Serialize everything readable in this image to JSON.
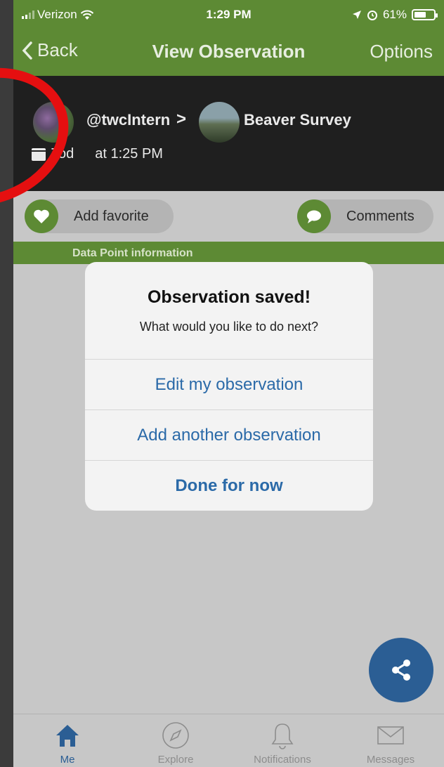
{
  "status_bar": {
    "carrier": "Verizon",
    "time": "1:29 PM",
    "battery_text": "61%",
    "battery_level": 0.61
  },
  "nav": {
    "back_label": "Back",
    "title": "View Observation",
    "options_label": "Options"
  },
  "header": {
    "username": "@twcIntern",
    "project": "Beaver Survey",
    "date_text": "Tod",
    "time_text": "at 1:25 PM"
  },
  "actions": {
    "favorite_label": "Add favorite",
    "comments_label": "Comments"
  },
  "section": {
    "title": "Data Point information"
  },
  "dialog": {
    "title": "Observation saved!",
    "message": "What would you like to do next?",
    "buttons": [
      "Edit my observation",
      "Add another observation",
      "Done for now"
    ]
  },
  "tabbar": {
    "items": [
      "Me",
      "Explore",
      "Notifications",
      "Messages"
    ]
  },
  "colors": {
    "brand_green": "#5d8a34",
    "accent_blue": "#2b5e94",
    "link_blue": "#2b6aa8",
    "annotation_red": "#e50f10"
  }
}
